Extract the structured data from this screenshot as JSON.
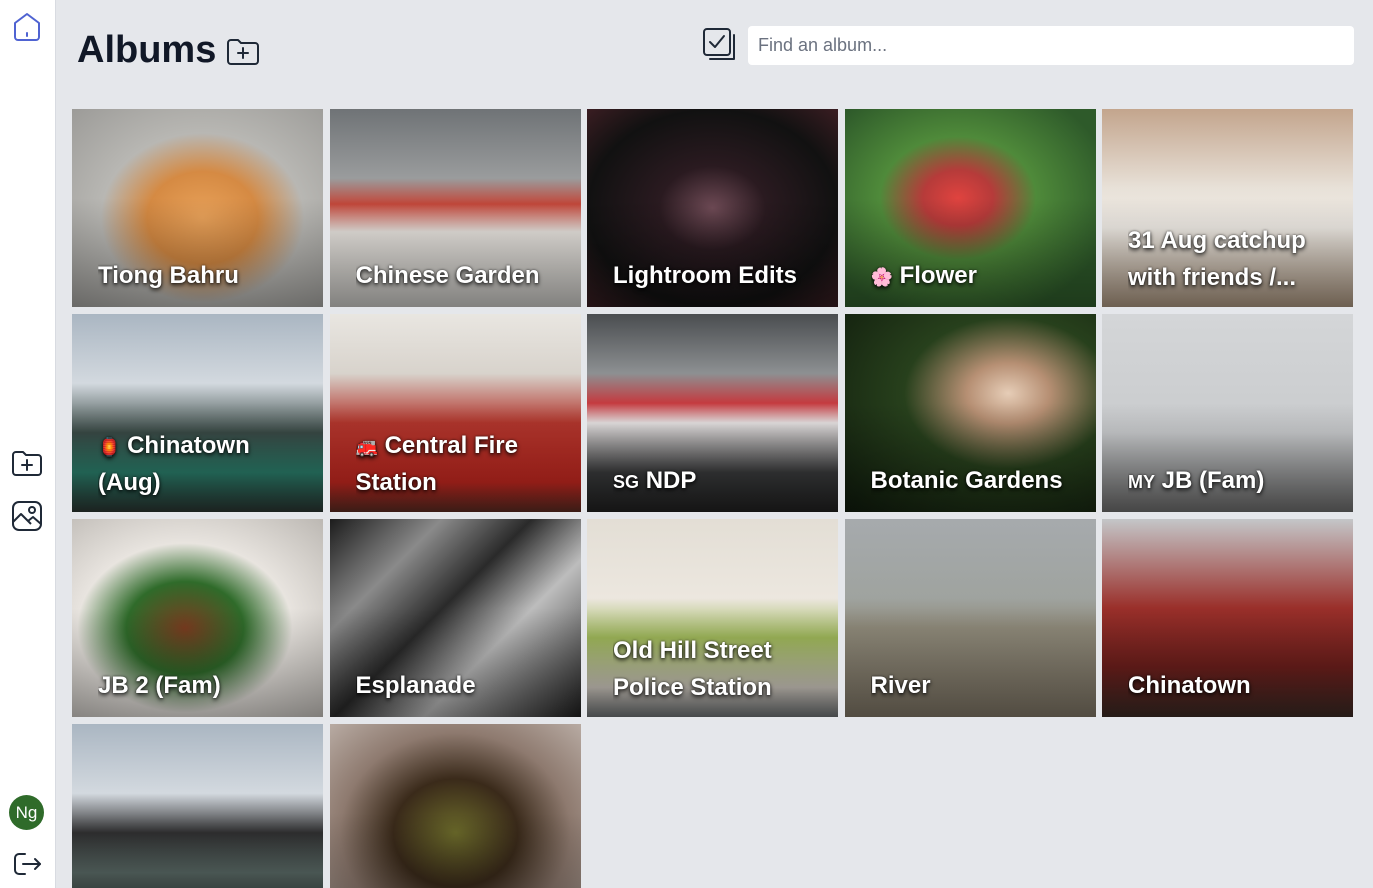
{
  "app": {
    "title": "Albums",
    "search_placeholder": "Find an album...",
    "search_value": ""
  },
  "sidebar": {
    "avatar_initials": "Ng"
  },
  "albums": [
    {
      "name": "Tiong Bahru",
      "emoji": ""
    },
    {
      "name": "Chinese Garden",
      "emoji": ""
    },
    {
      "name": "Lightroom Edits",
      "emoji": ""
    },
    {
      "name": "Flower",
      "emoji": "🌸"
    },
    {
      "name": "31 Aug catchup with friends /...",
      "emoji": ""
    },
    {
      "name": "Chinatown (Aug)",
      "emoji": "🏮"
    },
    {
      "name": "Central Fire Station",
      "emoji": "🚒"
    },
    {
      "name": "NDP",
      "emoji": "SG"
    },
    {
      "name": "Botanic Gardens",
      "emoji": ""
    },
    {
      "name": "JB (Fam)",
      "emoji": "MY"
    },
    {
      "name": "JB 2 (Fam)",
      "emoji": ""
    },
    {
      "name": "Esplanade",
      "emoji": ""
    },
    {
      "name": "Old Hill Street Police Station",
      "emoji": ""
    },
    {
      "name": "River",
      "emoji": ""
    },
    {
      "name": "Chinatown",
      "emoji": ""
    },
    {
      "name": "",
      "emoji": ""
    },
    {
      "name": "",
      "emoji": ""
    }
  ],
  "colors": {
    "background": "#e5e7eb",
    "sidebar": "#ffffff",
    "accent": "#4f63d2",
    "icon_dark": "#1f2937",
    "avatar": "#2f6b2a"
  }
}
